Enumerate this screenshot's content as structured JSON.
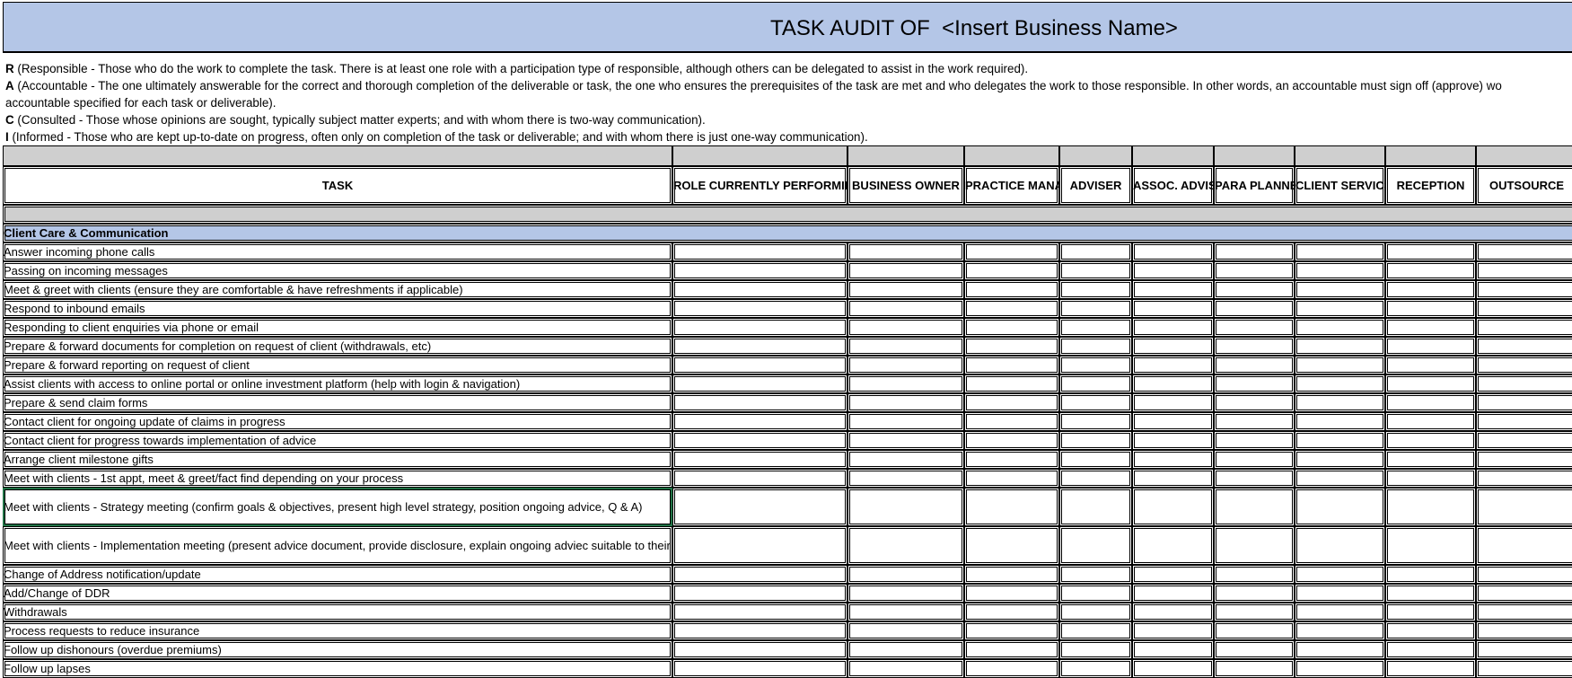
{
  "title": "TASK AUDIT OF  <Insert Business Name>",
  "legend": [
    {
      "letter": "R",
      "text": " (Responsible - Those who do the work to complete the task. There is at least one role with a participation type of responsible, although others can be delegated to assist in the work required)."
    },
    {
      "letter": "A",
      "text": " (Accountable - The one ultimately answerable for the correct and thorough completion of the deliverable or task, the one who ensures the prerequisites of the task are met and who delegates the work to those responsible. In other words, an accountable must sign off (approve) wo"
    },
    {
      "letter": "",
      "text": "accountable specified for each task or deliverable)."
    },
    {
      "letter": "C",
      "text": " (Consulted - Those whose opinions are sought, typically subject matter experts; and with whom there is two-way communication)."
    },
    {
      "letter": "I",
      "text": " (Informed - Those who are kept up-to-date on progress, often only on completion of the task or deliverable; and with whom there is just one-way communication)."
    }
  ],
  "columns": [
    "TASK",
    "ROLE CURRENTLY PERFORMING THIS TASK",
    "BUSINESS OWNER",
    "PRACTICE MANAGER",
    "ADVISER",
    "ASSOC. ADVISER",
    "PARA PLANNER",
    "CLIENT SERVICE",
    "RECEPTION",
    "OUTSOURCE"
  ],
  "section": "Client Care & Communication",
  "tasks": [
    "Answer incoming phone calls",
    "Passing on incoming messages",
    "Meet & greet with clients (ensure they are comfortable & have refreshments if applicable)",
    "Respond to inbound emails",
    "Responding to client enquiries via phone or email",
    "Prepare & forward documents for completion on request of client (withdrawals, etc)",
    "Prepare & forward reporting on request of client",
    "Assist clients with access to online portal or online investment platform (help with login & navigation)",
    "Prepare & send claim forms",
    "Contact client for ongoing update of claims in progress",
    "Contact client for progress towards implementation of advice",
    "Arrange client milestone gifts",
    "Meet with clients - 1st appt, meet & greet/fact find depending on your process",
    "Meet with clients - Strategy meeting (confirm goals & objectives, present high level strategy, position ongoing advice, Q & A)",
    "Meet with clients - Implementation meeting (present advice document, provide disclosure, explain ongoing adviec suitable to their needs, explain next steps, complete implementation)",
    "Change of Address notification/update",
    "Add/Change of DDR",
    "Withdrawals",
    "Process requests to reduce insurance",
    "Follow up dishonours (overdue premiums)",
    "Follow up lapses"
  ]
}
